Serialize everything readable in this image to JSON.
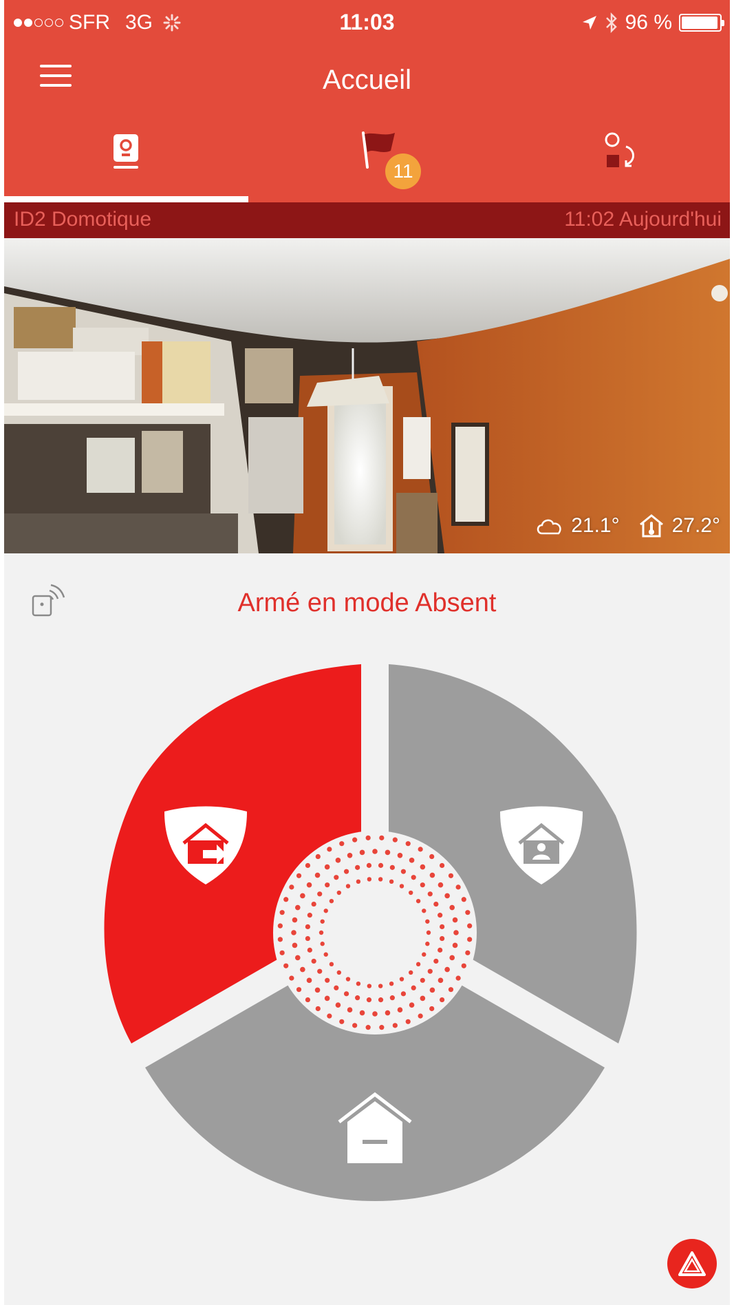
{
  "status_bar": {
    "carrier": "SFR",
    "network": "3G",
    "time": "11:03",
    "battery": "96 %",
    "battery_level": 0.96,
    "signal_dots_filled": 2,
    "signal_dots_total": 5
  },
  "nav": {
    "title": "Accueil"
  },
  "tabs": [
    {
      "name": "camera",
      "icon": "camera-icon",
      "active": true
    },
    {
      "name": "events",
      "icon": "flag-icon",
      "badge": "11"
    },
    {
      "name": "automation",
      "icon": "scenario-icon"
    }
  ],
  "camera": {
    "name": "ID2 Domotique",
    "timestamp": "11:02 Aujourd'hui",
    "outdoor_temp": "21.1°",
    "indoor_temp": "27.2°"
  },
  "alarm": {
    "status_text": "Armé en mode Absent",
    "active_mode": "away",
    "modes": [
      "away",
      "night",
      "disarmed"
    ]
  },
  "colors": {
    "header": "#e34b3b",
    "subbar": "#8d1616",
    "active": "#ec1c1c",
    "inactive": "#9d9d9d",
    "badge": "#f3a33c"
  }
}
